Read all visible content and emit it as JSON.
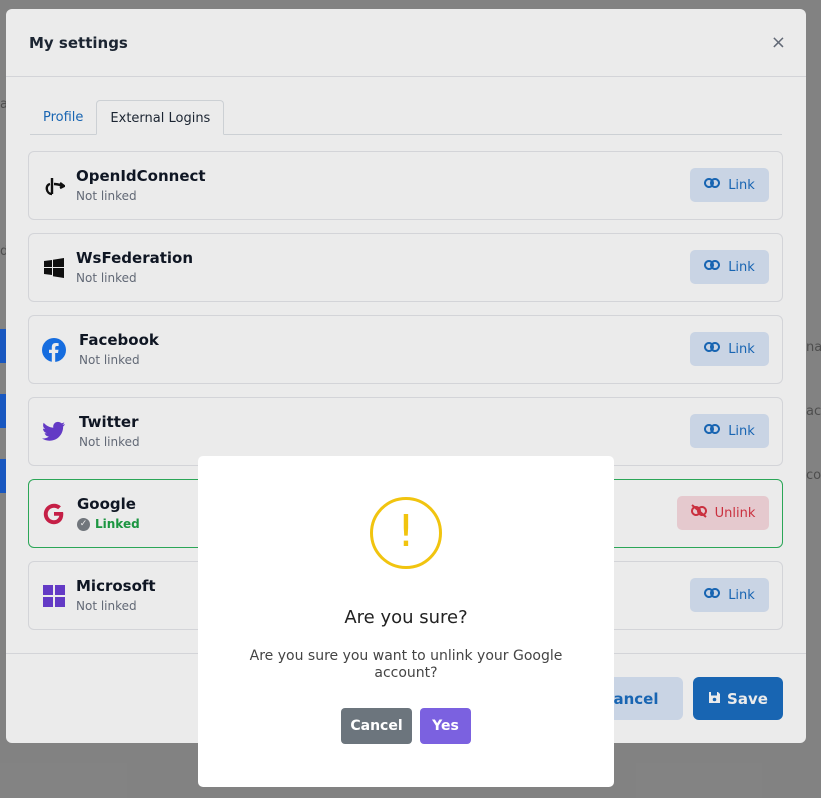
{
  "settings": {
    "title": "My settings",
    "close_symbol": "×"
  },
  "tabs": [
    {
      "label": "Profile",
      "active": false
    },
    {
      "label": "External Logins",
      "active": true
    }
  ],
  "providers": [
    {
      "name": "OpenIdConnect",
      "status": "Not linked",
      "action": "Link",
      "icon": "openid-icon"
    },
    {
      "name": "WsFederation",
      "status": "Not linked",
      "action": "Link",
      "icon": "windows-icon"
    },
    {
      "name": "Facebook",
      "status": "Not linked",
      "action": "Link",
      "icon": "facebook-icon"
    },
    {
      "name": "Twitter",
      "status": "Not linked",
      "action": "Link",
      "icon": "twitter-icon"
    },
    {
      "name": "Google",
      "status": "Linked",
      "action": "Unlink",
      "icon": "google-icon"
    },
    {
      "name": "Microsoft",
      "status": "Not linked",
      "action": "Link",
      "icon": "microsoft-icon"
    }
  ],
  "footer": {
    "cancel_label": "Cancel",
    "save_label": "Save"
  },
  "confirm": {
    "icon_symbol": "!",
    "title": "Are you sure?",
    "message": "Are you sure you want to unlink your Google account?",
    "cancel_label": "Cancel",
    "yes_label": "Yes"
  },
  "colors": {
    "primary": "#1b6ec2",
    "danger": "#dc3545",
    "success": "#1fa347",
    "warning": "#f1c40f",
    "confirm_button": "#7b61e0"
  }
}
